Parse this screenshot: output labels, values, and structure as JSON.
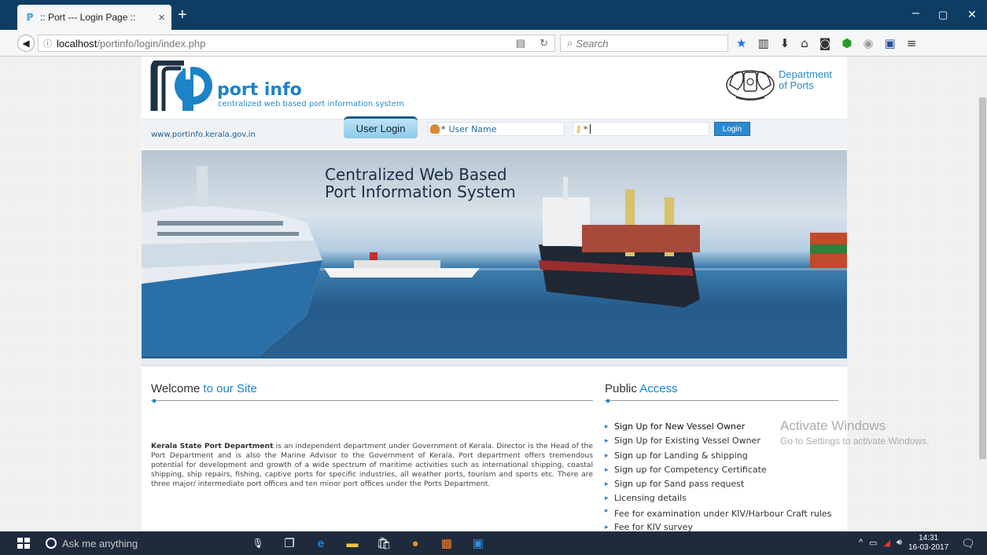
{
  "browser": {
    "tab_title": ":: Port --- Login Page ::",
    "tab_close": "×",
    "new_tab": "+",
    "url_host": "localhost",
    "url_path": "/portinfo/login/index.php",
    "search_placeholder": "Search",
    "window_controls": [
      "–",
      "▢",
      "✕"
    ]
  },
  "site": {
    "brand": "port info",
    "tagline": "centralized web based port information system",
    "dept_line1": "Department",
    "dept_line2": "of Ports",
    "web_url": "www.portinfo.kerala.gov.in"
  },
  "login": {
    "tab_label": "User Login",
    "username_placeholder": "User Name",
    "required_mark": "*",
    "button": "Login"
  },
  "banner": {
    "line1": "Centralized Web Based",
    "line2": "Port Information System"
  },
  "welcome": {
    "title_plain": "Welcome ",
    "title_accent": "to our Site",
    "body_bold": "Kerala State Port Department",
    "body_rest": " is an independent department under Government of Kerala. Director is the Head of the Port Department and is also the Marine Advisor to the Government of Kerala. Port department offers tremendous potential for development and growth of a wide spectrum of maritime activities such as international shipping, coastal shipping, ship repairs, fishing, captive ports for specific industries, all weather ports, tourism and sports etc. There are three major/ intermediate port offices and ten minor port offices under the Ports Department."
  },
  "public_access": {
    "title_plain": "Public ",
    "title_accent": "Access",
    "items": [
      "Sign Up for New Vessel Owner",
      "Sign Up for Existing Vessel Owner",
      "Sign up for Landing & shipping",
      "Sign up for Competency Certificate",
      "Sign up for Sand pass request",
      "Licensing details",
      "Fee for examination under KIV/Harbour Craft rules",
      "Fee for KIV survey"
    ]
  },
  "watermark": {
    "line1": "Activate Windows",
    "line2": "Go to Settings to activate Windows."
  },
  "taskbar": {
    "search_text": "Ask me anything",
    "time": "14:31",
    "date": "16-03-2017"
  }
}
